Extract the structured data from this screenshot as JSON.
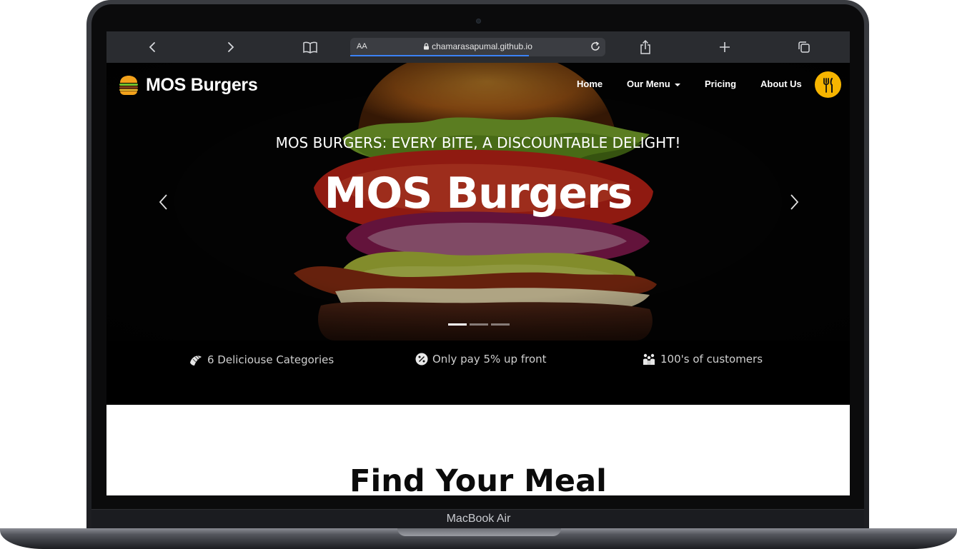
{
  "device": {
    "label": "MacBook Air"
  },
  "browser": {
    "text_size_label": "AA",
    "url": "chamarasapumal.github.io"
  },
  "navbar": {
    "brand": "MOS Burgers",
    "links": [
      {
        "label": "Home"
      },
      {
        "label": "Our Menu"
      },
      {
        "label": "Pricing"
      },
      {
        "label": "About Us"
      }
    ]
  },
  "hero": {
    "tagline": "MOS BURGERS: EVERY BITE, A DISCOUNTABLE DELIGHT!",
    "title": "MOS Burgers",
    "active_slide": 1,
    "slide_count": 3
  },
  "features": [
    {
      "icon": "croissant-icon",
      "text": "6 Deliciouse Categories"
    },
    {
      "icon": "percent-badge-icon",
      "text": "Only pay 5% up front"
    },
    {
      "icon": "people-icon",
      "text": "100's of customers"
    }
  ],
  "section": {
    "title": "Find Your Meal"
  },
  "colors": {
    "accent": "#f7b500",
    "toolbar": "#2a2c30",
    "progress": "#3b82f6"
  }
}
